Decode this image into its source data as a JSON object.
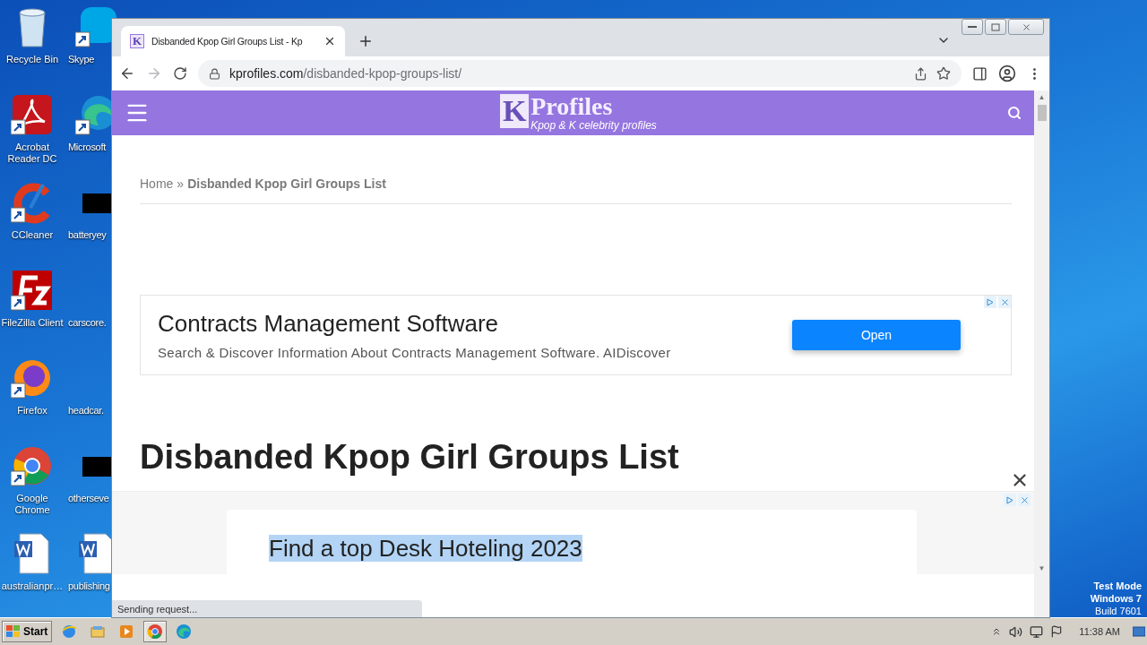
{
  "desktop": {
    "icons": [
      {
        "label": "Recycle Bin",
        "kind": "recycle-bin"
      },
      {
        "label": "Acrobat Reader DC",
        "kind": "pdf"
      },
      {
        "label": "CCleaner",
        "kind": "cleaner"
      },
      {
        "label": "FileZilla Client",
        "kind": "ftp"
      },
      {
        "label": "Firefox",
        "kind": "firefox"
      },
      {
        "label": "Google Chrome",
        "kind": "chrome"
      },
      {
        "label": "australianpr…",
        "kind": "word"
      }
    ],
    "icons_column_2": [
      {
        "label": "Skype",
        "kind": "skype"
      },
      {
        "label": "Microsoft",
        "kind": "edge"
      },
      {
        "label": "batteryey",
        "kind": "redacted"
      },
      {
        "label": "carscore.",
        "kind": "blank"
      },
      {
        "label": "headcar.",
        "kind": "blank"
      },
      {
        "label": "otherseve",
        "kind": "redacted"
      },
      {
        "label": "publishing",
        "kind": "word"
      }
    ],
    "os_notice": [
      "Test Mode",
      "Windows 7",
      "Build 7601"
    ]
  },
  "browser": {
    "tab": {
      "favicon_letter": "K",
      "title": "Disbanded Kpop Girl Groups List - Kp",
      "selected": true
    },
    "scrollbar": {
      "up": "▲",
      "down": "▼"
    },
    "back": {
      "disabled": false
    },
    "forward": {
      "disabled": true
    },
    "address": {
      "domain": "kprofiles.com",
      "path": "/disbanded-kpop-groups-list/"
    },
    "status": "Sending request..."
  },
  "site": {
    "logo": {
      "letter": "K",
      "name": "Profiles",
      "tagline": "Kpop & K celebrity profiles"
    },
    "breadcrumb": {
      "separator": "»",
      "items": [
        {
          "label": "Home",
          "current": false
        },
        {
          "label": "Disbanded Kpop Girl Groups List",
          "current": true
        }
      ]
    },
    "ad": {
      "title": "Contracts Management Software",
      "text": "Search & Discover Information About Contracts Management Software. AIDiscover",
      "button": "Open"
    },
    "heading": "Disbanded Kpop Girl Groups List",
    "sticky_ad": {
      "headline": "Find a top Desk Hoteling 2023",
      "highlighted": true
    }
  },
  "taskbar": {
    "start": "Start",
    "apps": [
      {
        "kind": "ie",
        "selected": false
      },
      {
        "kind": "explorer",
        "selected": false
      },
      {
        "kind": "media",
        "selected": false
      },
      {
        "kind": "chrome",
        "selected": true
      },
      {
        "kind": "edge",
        "selected": false
      }
    ],
    "clock": "11:38 AM"
  }
}
